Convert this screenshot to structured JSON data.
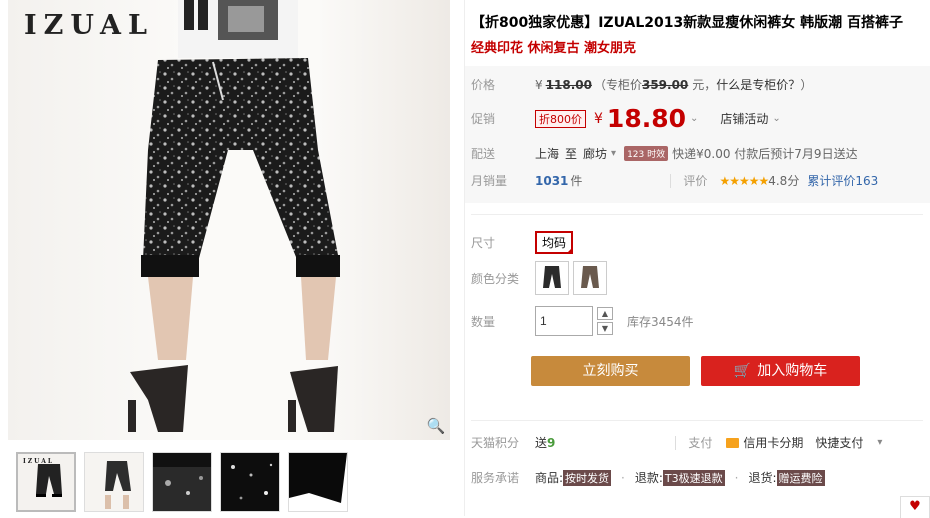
{
  "brand": "IZUAL",
  "product": {
    "title": "【折800独家优惠】IZUAL2013新款显瘦休闲裤女 韩版潮 百搭裤子",
    "subtitle": "经典印花 休闲复古 潮女朋克"
  },
  "price": {
    "label": "价格",
    "currency": "¥",
    "original": "118.00",
    "counter_prefix": "（专柜价",
    "counter_price": "359.00",
    "counter_suffix": "元，",
    "counter_link": "什么是专柜价？",
    "counter_close": "）"
  },
  "promo": {
    "label": "促销",
    "tag": "折800价",
    "currency": "¥",
    "price": "18.80",
    "store_activity": "店铺活动"
  },
  "shipping": {
    "label": "配送",
    "from": "上海",
    "to_word": "至",
    "to_city": "廊坊",
    "fast_tag": "123 时效",
    "text": "快递¥0.00 付款后预计7月9日送达"
  },
  "sales": {
    "label": "月销量",
    "count": "1031",
    "unit": "件",
    "review_label": "评价",
    "stars": "★★★★★",
    "score": "4.8分",
    "review_link": "累计评价163"
  },
  "options": {
    "size_label": "尺寸",
    "size_value": "均码",
    "color_label": "颜色分类",
    "qty_label": "数量",
    "qty_value": "1",
    "stock": "库存3454件"
  },
  "actions": {
    "buy_now": "立刻购买",
    "add_cart": "加入购物车"
  },
  "points": {
    "label": "天猫积分",
    "give": "送",
    "value": "9",
    "pay_label": "支付",
    "credit": "信用卡分期",
    "quick_pay": "快捷支付"
  },
  "service": {
    "label": "服务承诺",
    "goods": "商品:",
    "goods_tag": "按时发货",
    "refund": "退款:",
    "refund_tag": "T3极速退款",
    "return": "退货:",
    "return_tag": "赠运费险"
  },
  "colors": {
    "accent": "#c40000",
    "buy_button": "#c78a3c",
    "cart_button": "#d9221e"
  }
}
